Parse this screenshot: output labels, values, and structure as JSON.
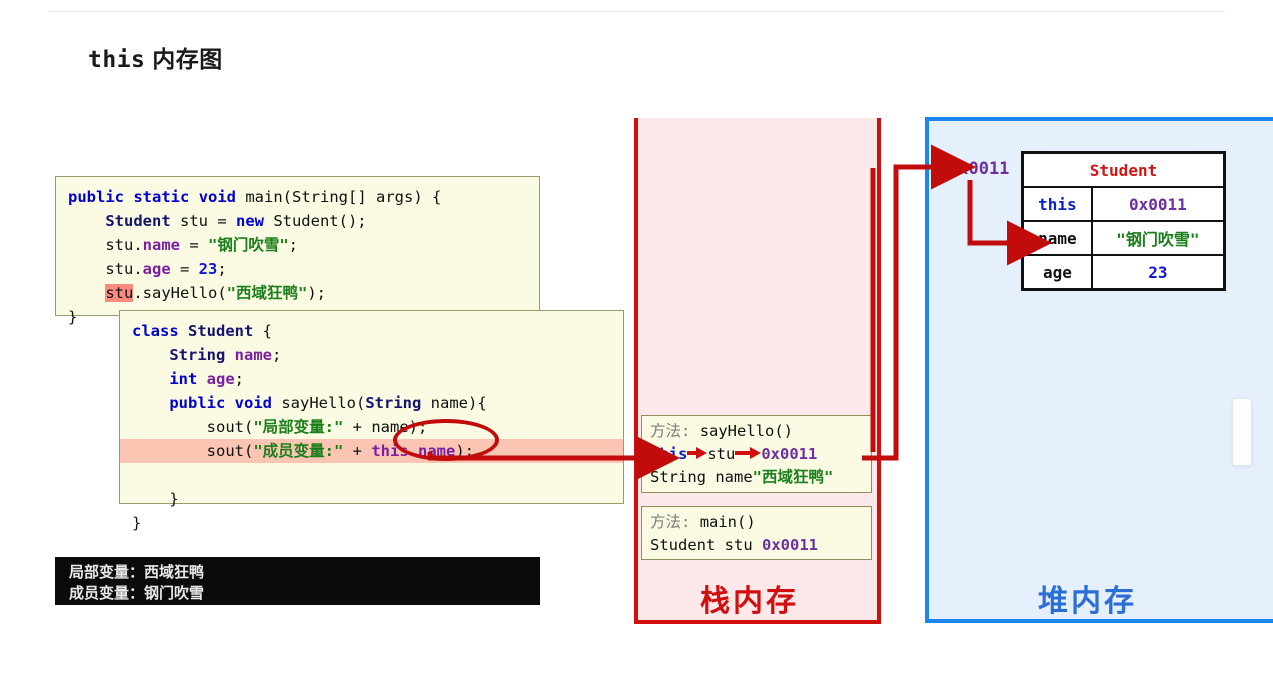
{
  "title": {
    "mono": "this",
    "cn": "内存图"
  },
  "code_main": {
    "name": "main-method-code",
    "lines": [
      "public static void main(String[] args) {",
      "    Student stu = new Student();",
      "    stu.name = \"钢门吹雪\";",
      "    stu.age = 23;",
      "    stu.sayHello(\"西域狂鸭\");",
      "}"
    ],
    "highlighted_token": "stu"
  },
  "code_class": {
    "name": "student-class-code",
    "lines": [
      "class Student {",
      "    String name;",
      "    int age;",
      "    public void sayHello(String name){",
      "        sout(\"局部变量:\" + name);",
      "        sout(\"成员变量:\" + this.name);",
      "    }",
      "}"
    ],
    "highlighted_line": "        sout(\"成员变量:\" + this.name);",
    "circled_token": "this.name"
  },
  "stack": {
    "label": "栈内存",
    "color": "#d10f0f",
    "frames": [
      {
        "title_label": "方法:",
        "title_value": "sayHello()",
        "rows": [
          {
            "key": "this",
            "mid": "stu",
            "value": "0x0011"
          },
          {
            "key": "String name",
            "value": "\"西域狂鸭\""
          }
        ]
      },
      {
        "title_label": "方法:",
        "title_value": "main()",
        "rows": [
          {
            "key": "Student stu",
            "value": "0x0011"
          }
        ]
      }
    ]
  },
  "heap": {
    "label": "堆内存",
    "color": "#1a86ee",
    "address": "0x0011",
    "object": {
      "title": "Student",
      "rows": [
        {
          "key": "this",
          "value": "0x0011",
          "key_color": "#0a22c8",
          "value_color": "#6b2fa0"
        },
        {
          "key": "name",
          "value": "\"钢门吹雪\"",
          "key_color": "#111111",
          "value_color": "#1a7f1a"
        },
        {
          "key": "age",
          "value": "23",
          "key_color": "#111111",
          "value_color": "#1414d6"
        }
      ]
    }
  },
  "console": {
    "name": "console-output",
    "lines": [
      "局部变量：西域狂鸭",
      "成员变量：钢门吹雪"
    ]
  }
}
